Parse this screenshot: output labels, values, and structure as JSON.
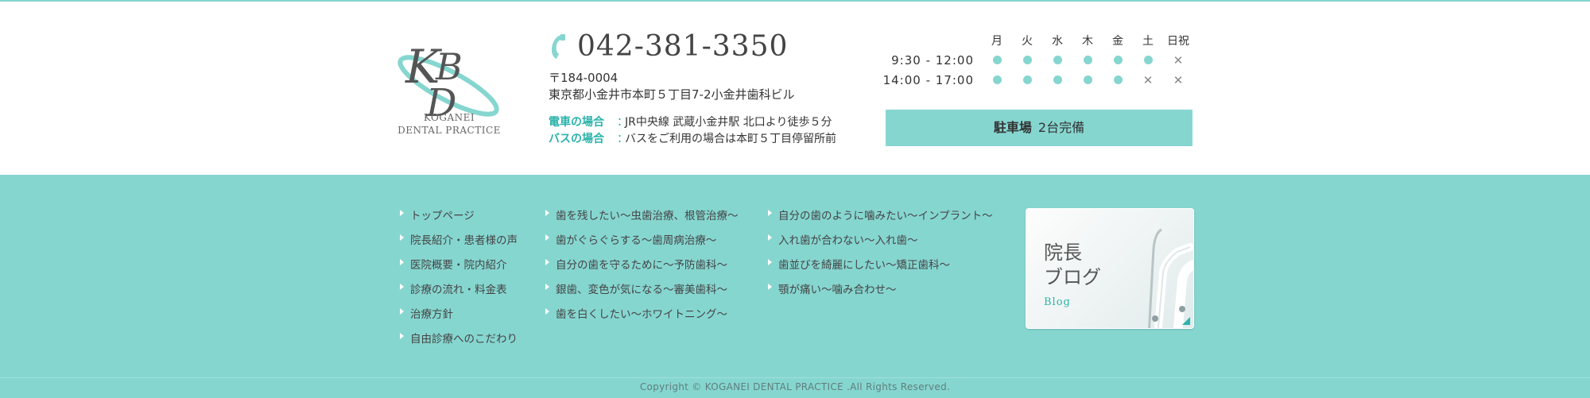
{
  "logo": {
    "monogram": "KDB",
    "subtitle_line1": "KOGANEI",
    "subtitle_line2": "DENTAL PRACTICE"
  },
  "contact": {
    "phone": "042-381-3350",
    "postal": "〒184-0004",
    "address": "東京都小金井市本町５丁目7-2小金井歯科ビル"
  },
  "access": [
    {
      "label": "電車の場合",
      "sep": "：",
      "text": "JR中央線 武蔵小金井駅 北口より徒歩５分"
    },
    {
      "label": "バスの場合",
      "sep": "：",
      "text": "バスをご利用の場合は本町５丁目停留所前"
    }
  ],
  "schedule": {
    "days": [
      "月",
      "火",
      "水",
      "木",
      "金",
      "土",
      "日祝"
    ],
    "rows": [
      {
        "time": "9:30 - 12:00",
        "cells": [
          "dot",
          "dot",
          "dot",
          "dot",
          "dot",
          "dot",
          "cross"
        ]
      },
      {
        "time": "14:00 - 17:00",
        "cells": [
          "dot",
          "dot",
          "dot",
          "dot",
          "dot",
          "cross",
          "cross"
        ]
      }
    ]
  },
  "parking": {
    "label": "駐車場",
    "text": "2台完備"
  },
  "nav": {
    "col1": [
      "トップページ",
      "院長紹介・患者様の声",
      "医院概要・院内紹介",
      "診療の流れ・料金表",
      "治療方針",
      "自由診療へのこだわり"
    ],
    "col2": [
      "歯を残したい～虫歯治療、根管治療～",
      "歯がぐらぐらする～歯周病治療～",
      "自分の歯を守るために～予防歯科～",
      "銀歯、変色が気になる～審美歯科～",
      "歯を白くしたい～ホワイトニング～"
    ],
    "col3": [
      "自分の歯のように噛みたい～インプラント～",
      "入れ歯が合わない～入れ歯～",
      "歯並びを綺麗にしたい～矯正歯科～",
      "顎が痛い～噛み合わせ～"
    ]
  },
  "blog": {
    "title_line1": "院長",
    "title_line2": "ブログ",
    "sub": "Blog"
  },
  "footer": {
    "copyright": "Copyright © KOGANEI DENTAL PRACTICE .All Rights Reserved."
  },
  "colors": {
    "accent": "#86d6d0",
    "accent_text": "#2bb3aa",
    "saturday": "#34a6d0",
    "holiday": "#e2462b"
  }
}
